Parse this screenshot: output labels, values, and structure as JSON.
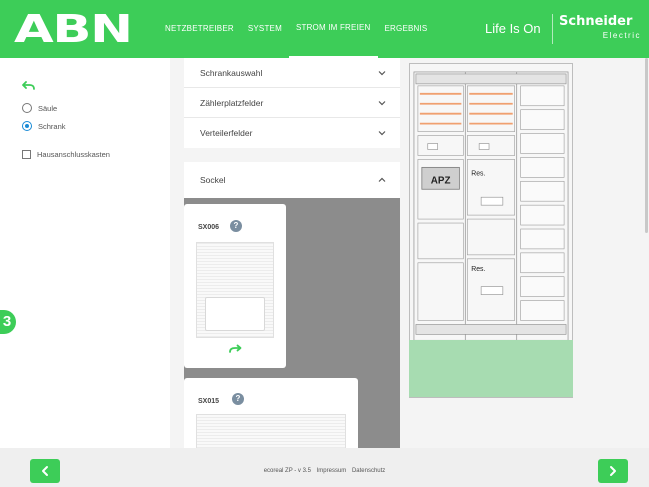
{
  "header": {
    "logo": "ABN",
    "nav": [
      {
        "label": "NETZBETREIBER",
        "active": false
      },
      {
        "label": "SYSTEM",
        "active": false
      },
      {
        "label": "STROM IM FREIEN",
        "active": true
      },
      {
        "label": "ERGEBNIS",
        "active": false
      }
    ],
    "tagline": "Life Is On",
    "brand": "Schneider",
    "brand_sub": "Electric"
  },
  "options": {
    "radio": [
      {
        "label": "Säule",
        "checked": false
      },
      {
        "label": "Schrank",
        "checked": true
      }
    ],
    "checkbox": {
      "label": "Hausanschlusskasten",
      "checked": false
    }
  },
  "step_badge": "3",
  "accordion": [
    {
      "label": "Schrankauswahl",
      "expanded": false
    },
    {
      "label": "Zählerplatzfelder",
      "expanded": false
    },
    {
      "label": "Verteilerfelder",
      "expanded": false
    },
    {
      "label": "Sockel",
      "expanded": true
    }
  ],
  "products": [
    {
      "code": "SX006",
      "help": "?"
    },
    {
      "code": "SX015",
      "help": "?"
    }
  ],
  "cabinet": {
    "apz_label": "APZ",
    "res_label": "Res."
  },
  "footer": {
    "version": "ecoreal ZP - v 3.5",
    "imprint": "Impressum",
    "privacy": "Datenschutz"
  },
  "colors": {
    "accent": "#3dcd58",
    "plinth": "#a7dcb1",
    "selected": "#1a8bd6",
    "module_bar": "#f0a070"
  },
  "icons": {
    "undo": "undo-icon",
    "chevron": "chevron-icon",
    "help": "help-icon",
    "back": "chevron-left-icon",
    "next": "chevron-right-icon"
  }
}
